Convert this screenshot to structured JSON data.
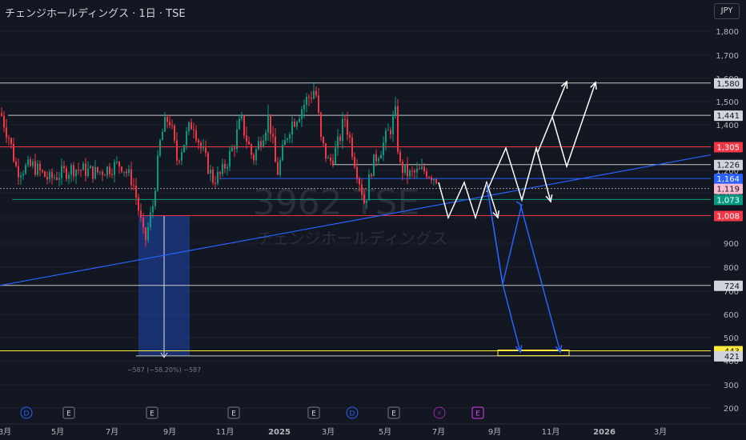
{
  "header": {
    "title": "チェンジホールディングス · 1日 · TSE",
    "currency": "JPY"
  },
  "watermark": {
    "symbol": "3962 TSE",
    "name": "チェンジホールディングス"
  },
  "measure": {
    "label": "−587 (−58.20%) −587"
  },
  "events": [
    {
      "label": "D",
      "color": "#2962ff"
    },
    {
      "label": "E",
      "color": "#787b86"
    },
    {
      "label": "E",
      "color": "#787b86"
    },
    {
      "label": "E",
      "color": "#787b86"
    },
    {
      "label": "E",
      "color": "#787b86"
    },
    {
      "label": "D",
      "color": "#2962ff"
    },
    {
      "label": "E",
      "color": "#787b86"
    },
    {
      "label": "⚡",
      "color": "#9c27b0"
    },
    {
      "label": "E",
      "color": "#e040fb"
    }
  ],
  "chart_data": {
    "type": "line",
    "y_scale": "log",
    "y_ticks": [
      200,
      300,
      400,
      500,
      600,
      700,
      800,
      900,
      1000,
      1100,
      1200,
      1300,
      1400,
      1500,
      1600,
      1700,
      1800
    ],
    "y_tick_labels": [
      "200",
      "300",
      "400",
      "500",
      "600",
      "700",
      "800",
      "900",
      "1,000",
      "1,100",
      "1,200",
      "1,300",
      "1,400",
      "1,500",
      "1,600",
      "1,700",
      "1,800"
    ],
    "x_tick_labels": [
      "3月",
      "5月",
      "7月",
      "9月",
      "11月",
      "2025",
      "3月",
      "5月",
      "7月",
      "9月",
      "11月",
      "2026",
      "3月"
    ],
    "price_levels": [
      {
        "label": "1,580",
        "value": 1580,
        "color": "#c8c8c8"
      },
      {
        "label": "1,441",
        "value": 1441,
        "color": "#c8c8c8"
      },
      {
        "label": "1,305",
        "value": 1305,
        "color": "#f23645"
      },
      {
        "label": "1,226",
        "value": 1226,
        "color": "#c8c8c8"
      },
      {
        "label": "1,164",
        "value": 1164,
        "color": "#2962ff"
      },
      {
        "label": "1,119",
        "value": 1119,
        "color": "#f8bbd0"
      },
      {
        "label": "1,073",
        "value": 1073,
        "color": "#089981"
      },
      {
        "label": "1,008",
        "value": 1008,
        "color": "#f23645"
      },
      {
        "label": "724",
        "value": 724,
        "color": "#c8c8c8"
      },
      {
        "label": "443",
        "value": 443,
        "color": "#ffeb3b"
      },
      {
        "label": "421",
        "value": 421,
        "color": "#c8c8c8"
      }
    ],
    "colors": {
      "up": "#089981",
      "down": "#f23645",
      "trend": "#2962ff",
      "projection_white": "#ffffff",
      "projection_blue": "#2962ff"
    }
  }
}
